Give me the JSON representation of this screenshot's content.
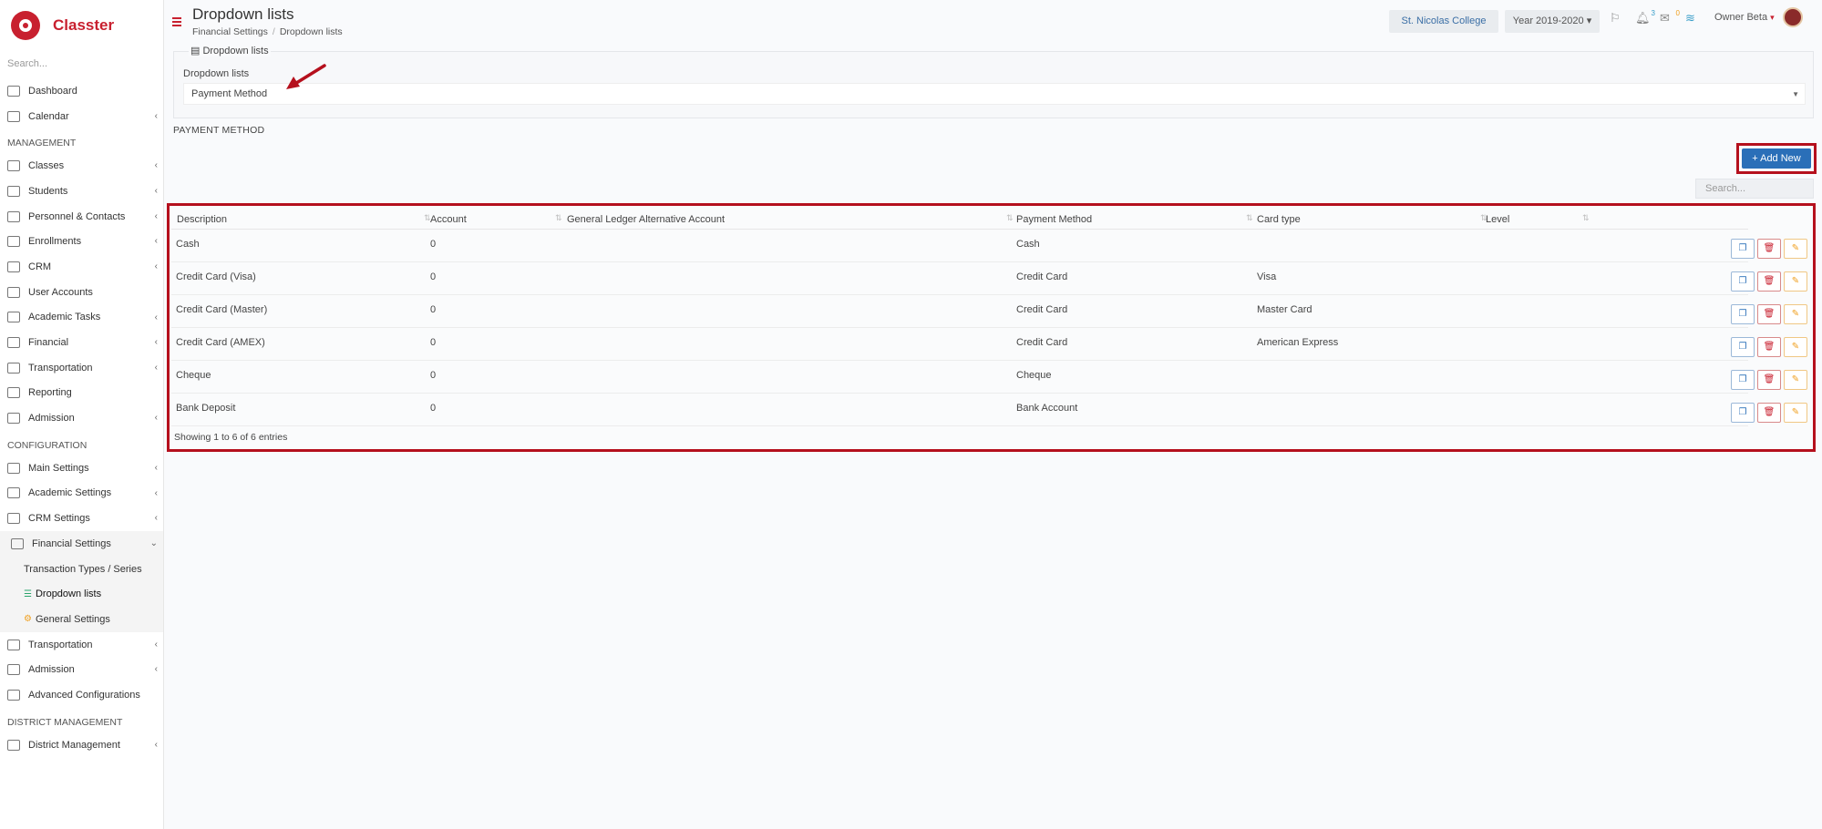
{
  "app": {
    "name": "Classter"
  },
  "sidebar": {
    "search_placeholder": "Search...",
    "top_items": [
      {
        "label": "Dashboard"
      },
      {
        "label": "Calendar"
      }
    ],
    "management_title": "MANAGEMENT",
    "management_items": [
      {
        "label": "Classes"
      },
      {
        "label": "Students"
      },
      {
        "label": "Personnel & Contacts"
      },
      {
        "label": "Enrollments"
      },
      {
        "label": "CRM"
      },
      {
        "label": "User Accounts"
      },
      {
        "label": "Academic Tasks"
      },
      {
        "label": "Financial"
      },
      {
        "label": "Transportation"
      },
      {
        "label": "Reporting"
      },
      {
        "label": "Admission"
      }
    ],
    "configuration_title": "CONFIGURATION",
    "configuration_items": [
      {
        "label": "Main Settings"
      },
      {
        "label": "Academic Settings"
      },
      {
        "label": "CRM Settings"
      },
      {
        "label": "Financial Settings"
      }
    ],
    "financial_sub": [
      {
        "label": "Transaction Types / Series"
      },
      {
        "label": "Dropdown lists"
      },
      {
        "label": "General Settings"
      }
    ],
    "configuration_items_after": [
      {
        "label": "Transportation"
      },
      {
        "label": "Admission"
      },
      {
        "label": "Advanced Configurations"
      }
    ],
    "district_title": "DISTRICT MANAGEMENT",
    "district_items": [
      {
        "label": "District Management"
      }
    ]
  },
  "header": {
    "title": "Dropdown lists",
    "breadcrumb": [
      "Financial Settings",
      "Dropdown lists"
    ],
    "school": "St. Nicolas College",
    "year": "Year 2019-2020",
    "notifications_count": "3",
    "messages_count": "0",
    "user": "Owner Beta"
  },
  "filter": {
    "legend": "Dropdown lists",
    "label": "Dropdown lists",
    "selected": "Payment Method"
  },
  "list": {
    "section_title": "PAYMENT METHOD",
    "add_label": "+ Add New",
    "search_placeholder": "Search...",
    "columns": [
      "Description",
      "Account",
      "General Ledger Alternative Account",
      "Payment Method",
      "Card type",
      "Level"
    ],
    "rows": [
      {
        "description": "Cash",
        "account": "0",
        "gl_alt": "",
        "method": "Cash",
        "card": "",
        "level": ""
      },
      {
        "description": "Credit Card (Visa)",
        "account": "0",
        "gl_alt": "",
        "method": "Credit Card",
        "card": "Visa",
        "level": ""
      },
      {
        "description": "Credit Card (Master)",
        "account": "0",
        "gl_alt": "",
        "method": "Credit Card",
        "card": "Master Card",
        "level": ""
      },
      {
        "description": "Credit Card (AMEX)",
        "account": "0",
        "gl_alt": "",
        "method": "Credit Card",
        "card": "American Express",
        "level": ""
      },
      {
        "description": "Cheque",
        "account": "0",
        "gl_alt": "",
        "method": "Cheque",
        "card": "",
        "level": ""
      },
      {
        "description": "Bank Deposit",
        "account": "0",
        "gl_alt": "",
        "method": "Bank Account",
        "card": "",
        "level": ""
      }
    ],
    "info": "Showing 1 to 6 of 6 entries"
  },
  "colors": {
    "brand": "#c8202f",
    "primary": "#2a6fb8",
    "highlight": "#b5101d"
  }
}
